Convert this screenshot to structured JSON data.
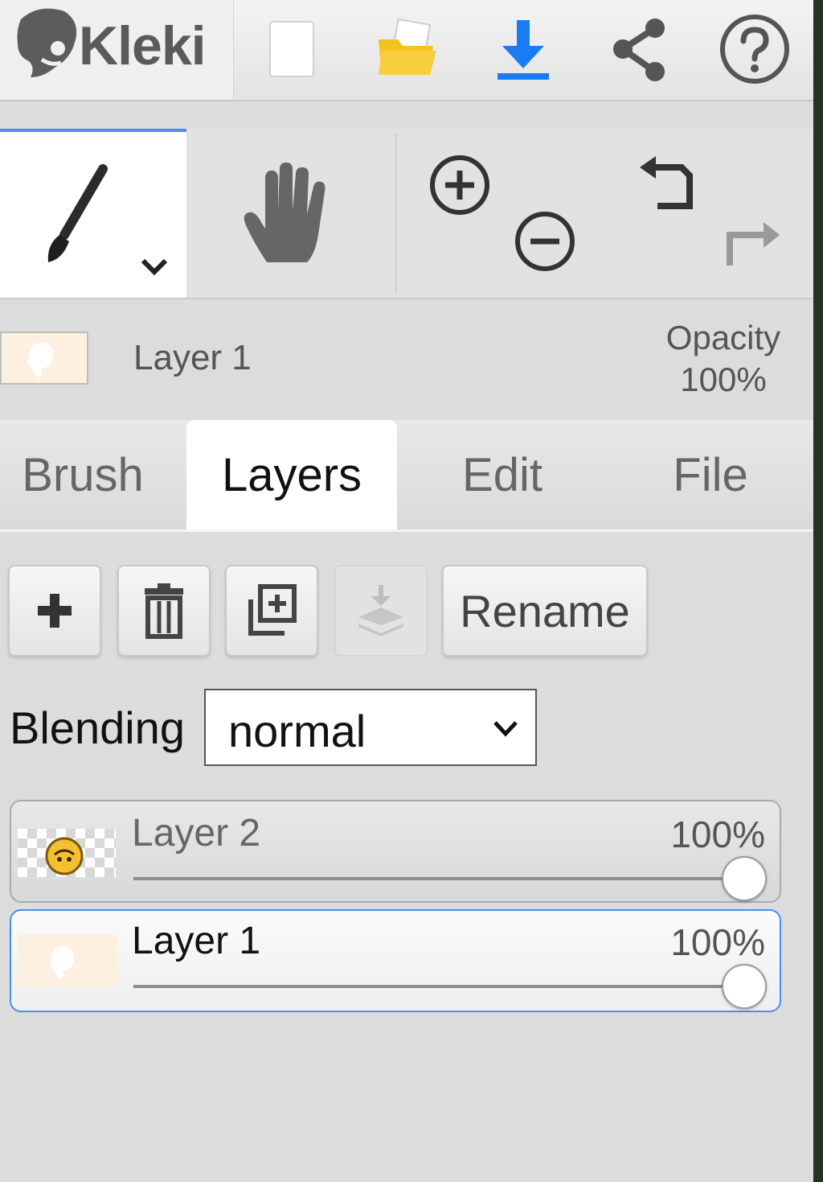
{
  "app": {
    "name": "Kleki"
  },
  "colors": {
    "accent": "#4a8cf0",
    "download": "#1a7cf5",
    "folder": "#f4c21c"
  },
  "topbar": {
    "icons": [
      "kleki-logo-icon",
      "new-file-icon",
      "open-folder-icon",
      "download-icon",
      "share-icon",
      "help-icon"
    ]
  },
  "tools": {
    "icons": [
      "brush-icon",
      "chevron-down-icon",
      "hand-icon",
      "zoom-in-icon",
      "zoom-out-icon",
      "undo-icon",
      "redo-icon"
    ]
  },
  "current_layer": {
    "name": "Layer 1",
    "opacity_label": "Opacity",
    "opacity_value": "100%"
  },
  "tabs": [
    {
      "label": "Brush",
      "active": false
    },
    {
      "label": "Layers",
      "active": true
    },
    {
      "label": "Edit",
      "active": false
    },
    {
      "label": "File",
      "active": false
    }
  ],
  "layer_actions": {
    "icons": [
      "add-layer-icon",
      "delete-layer-icon",
      "duplicate-layer-icon",
      "merge-down-icon"
    ],
    "rename_label": "Rename"
  },
  "blending": {
    "label": "Blending",
    "value": "normal"
  },
  "layers": [
    {
      "name": "Layer 2",
      "opacity": "100%",
      "opacity_fraction": 1.0,
      "selected": false
    },
    {
      "name": "Layer 1",
      "opacity": "100%",
      "opacity_fraction": 1.0,
      "selected": true
    }
  ]
}
